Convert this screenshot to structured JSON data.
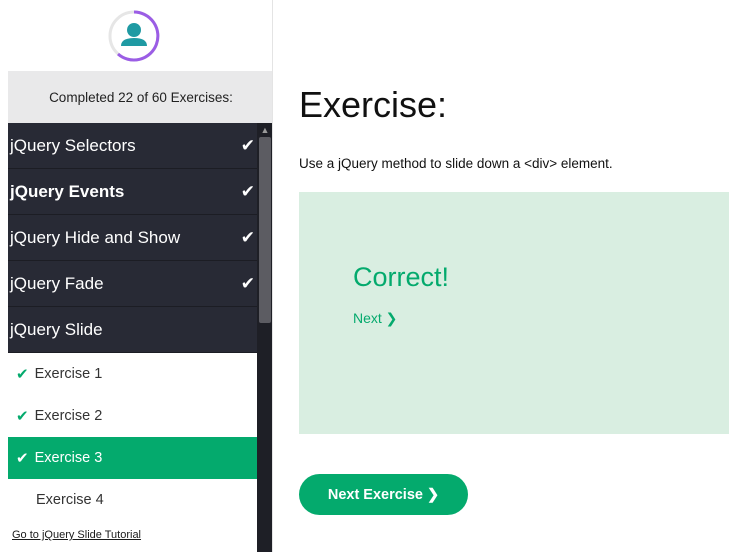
{
  "sidebar": {
    "progress_text": "Completed 22 of 60 Exercises:",
    "sections": [
      {
        "label": "jQuery Selectors",
        "check": "✔"
      },
      {
        "label": "jQuery Events",
        "check": "✔"
      },
      {
        "label": "jQuery Hide and Show",
        "check": "✔"
      },
      {
        "label": "jQuery Fade",
        "check": "✔"
      },
      {
        "label": "jQuery Slide",
        "check": ""
      }
    ],
    "exercises": [
      {
        "label": "Exercise 1",
        "tick": "✔"
      },
      {
        "label": "Exercise 2",
        "tick": "✔"
      },
      {
        "label": "Exercise 3",
        "tick": "✔"
      },
      {
        "label": "Exercise 4",
        "tick": ""
      }
    ],
    "tutorial_link": "Go to jQuery Slide Tutorial"
  },
  "main": {
    "title": "Exercise:",
    "description": "Use a jQuery method to slide down a <div> element.",
    "result": "Correct!",
    "next_link": "Next ❯",
    "next_button": "Next Exercise ❯"
  },
  "colors": {
    "accent": "#04aa6d",
    "sidebar_dark": "#282a35",
    "result_bg": "#d9eee1"
  }
}
